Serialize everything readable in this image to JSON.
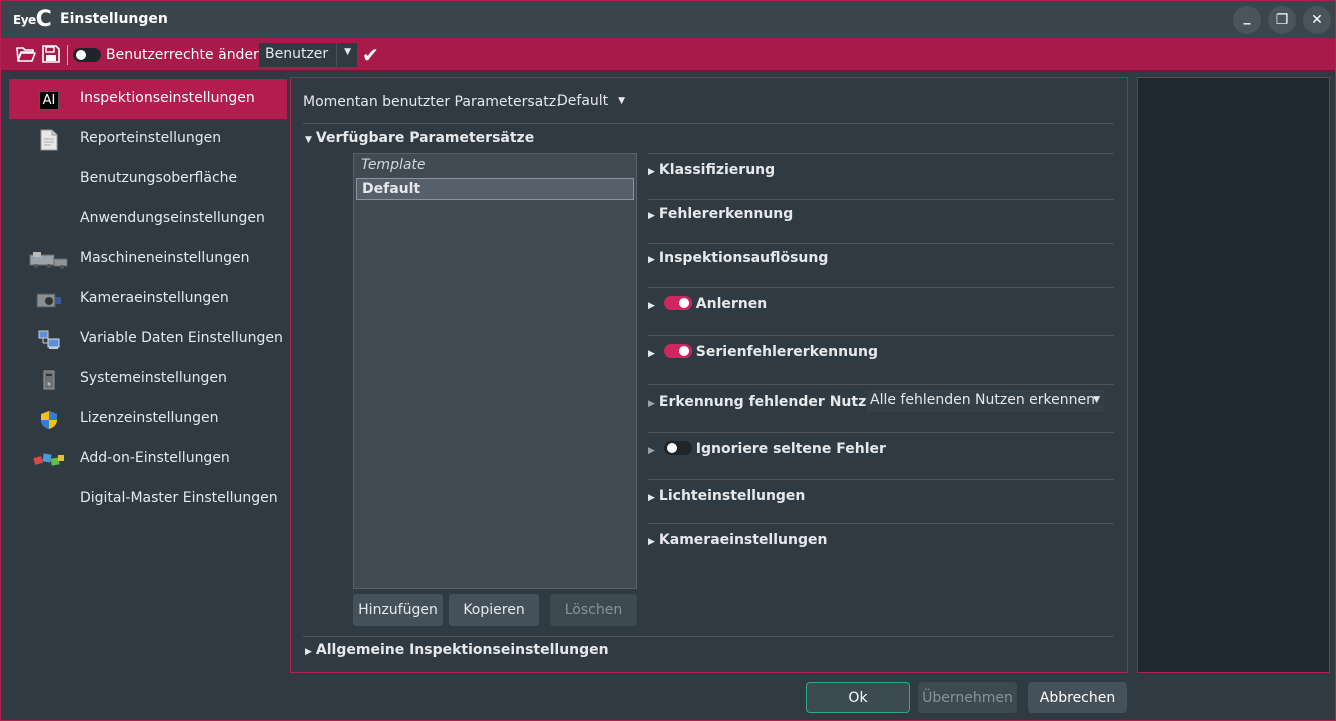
{
  "window": {
    "logo_eye": "Eye",
    "logo_c": "C",
    "title": "Einstellungen",
    "controls": {
      "minimize": "_",
      "restore": "❐",
      "close": "✕"
    }
  },
  "toolbar": {
    "user_rights_label": "Benutzerrechte ändern",
    "user_rights_enabled": false,
    "user_combo_value": "Benutzer",
    "apply_glyph": "✔"
  },
  "sidebar": {
    "items": [
      {
        "label": "Inspektionseinstellungen",
        "icon": "ai-icon",
        "icon_text": "AI",
        "active": true
      },
      {
        "label": "Reporteinstellungen",
        "icon": "document-icon"
      },
      {
        "label": "Benutzungsoberfläche",
        "icon": ""
      },
      {
        "label": "Anwendungseinstellungen",
        "icon": ""
      },
      {
        "label": "Maschineneinstellungen",
        "icon": "machine-icon"
      },
      {
        "label": "Kameraeinstellungen",
        "icon": "camera-icon"
      },
      {
        "label": "Variable Daten Einstellungen",
        "icon": "network-computer-icon"
      },
      {
        "label": "Systemeinstellungen",
        "icon": "computer-tower-icon"
      },
      {
        "label": "Lizenzeinstellungen",
        "icon": "shield-icon"
      },
      {
        "label": "Add-on-Einstellungen",
        "icon": "puzzle-icon"
      },
      {
        "label": "Digital-Master Einstellungen",
        "icon": ""
      }
    ]
  },
  "main": {
    "current_param_label": "Momentan benutzter Parametersatz:",
    "current_param_value": "Default",
    "available_header": "Verfügbare Parametersätze",
    "param_sets": [
      {
        "name": "Template",
        "italic": true
      },
      {
        "name": "Default",
        "selected": true
      }
    ],
    "buttons": {
      "add": "Hinzufügen",
      "copy": "Kopieren",
      "delete": "Löschen"
    },
    "sections": [
      {
        "label": "Klassifizierung"
      },
      {
        "label": "Fehlererkennung"
      },
      {
        "label": "Inspektionsauflösung"
      },
      {
        "label": "Anlernen",
        "toggle": "on"
      },
      {
        "label": "Serienfehlererkennung",
        "toggle": "on"
      },
      {
        "label": "Erkennung fehlender Nutzen",
        "combo": "Alle fehlenden Nutzen erkennen"
      },
      {
        "label": "Ignoriere seltene Fehler",
        "toggle": "off"
      },
      {
        "label": "Lichteinstellungen"
      },
      {
        "label": "Kameraeinstellungen"
      }
    ],
    "general_header": "Allgemeine Inspektionseinstellungen"
  },
  "footer": {
    "ok": "Ok",
    "apply": "Übernehmen",
    "cancel": "Abbrechen"
  },
  "colors": {
    "accent": "#b21c4e",
    "background": "#2f3a42",
    "titlebar": "#3a454d",
    "ok_border": "#2fa88a"
  }
}
